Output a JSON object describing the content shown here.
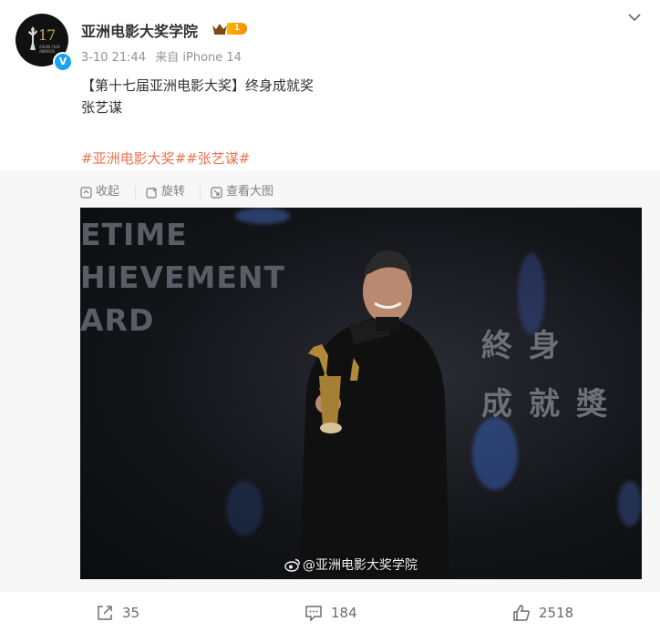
{
  "author": {
    "name": "亚洲电影大奖学院",
    "avatar_number": "17",
    "avatar_caption": "ASIAN FILM AWARDS",
    "level": "1",
    "verified_mark": "V"
  },
  "meta": {
    "time": "3-10 21:44",
    "source": "来自 iPhone 14"
  },
  "post": {
    "lines": [
      "【第十七届亚洲电影大奖】终身成就奖",
      "张艺谋"
    ],
    "hashtags": [
      "#亚洲电影大奖#",
      "#张艺谋#"
    ]
  },
  "media_toolbar": {
    "collapse": "收起",
    "rotate": "旋转",
    "view_large": "查看大图"
  },
  "photo": {
    "backdrop_en": "ETIME\nHIEVEMENT\nARD",
    "backdrop_cn": "終身\n成就獎",
    "watermark": "@亚洲电影大奖学院"
  },
  "actions": {
    "repost_count": "35",
    "comment_count": "184",
    "like_count": "2518"
  },
  "colors": {
    "hashtag": "#eb7350",
    "meta": "#939393",
    "verified": "#1da1f2",
    "level_badge": "#ff9a00"
  },
  "icons": [
    "crown-icon",
    "chevron-down-icon",
    "collapse-icon",
    "rotate-icon",
    "view-large-icon",
    "weibo-logo-icon",
    "repost-icon",
    "comment-icon",
    "like-icon"
  ]
}
